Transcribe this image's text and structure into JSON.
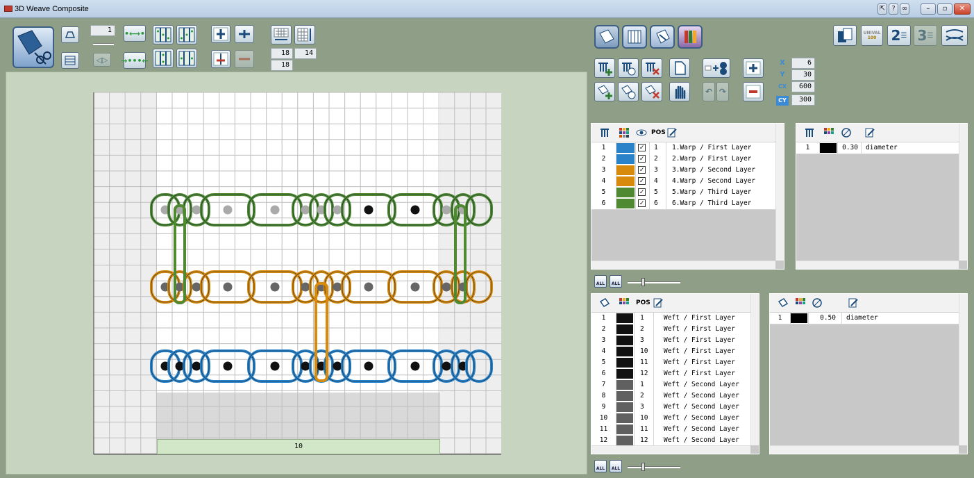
{
  "window": {
    "title": "3D Weave Composite"
  },
  "toolbar_left": {
    "layer_count_value": "1",
    "warp_count_value": "18",
    "weft_count_value": "14",
    "pass_value": "18"
  },
  "canvas": {
    "ruler_label": "10"
  },
  "toolbar_right": {
    "coord_x_label": "X",
    "coord_x_value": "6",
    "coord_y_label": "Y",
    "coord_y_value": "30",
    "coord_cx_label": "CX",
    "coord_cx_value": "600",
    "coord_cy_label": "CY",
    "coord_cy_value": "300",
    "unival_label": "UNIVAL",
    "unival_sub": "100"
  },
  "warp_table": {
    "col_pos": "POS",
    "rows": [
      {
        "idx": "1",
        "pos": "1",
        "name": "1.Warp / First Layer",
        "color": "#2a82c8"
      },
      {
        "idx": "2",
        "pos": "2",
        "name": "2.Warp / First Layer",
        "color": "#2a82c8"
      },
      {
        "idx": "3",
        "pos": "3",
        "name": "3.Warp / Second Layer",
        "color": "#d88a0c"
      },
      {
        "idx": "4",
        "pos": "4",
        "name": "4.Warp / Second Layer",
        "color": "#d88a0c"
      },
      {
        "idx": "5",
        "pos": "5",
        "name": "5.Warp / Third Layer",
        "color": "#4f8a32"
      },
      {
        "idx": "6",
        "pos": "6",
        "name": "6.Warp / Third Layer",
        "color": "#4f8a32"
      }
    ]
  },
  "warp_yarn_table": {
    "rows": [
      {
        "idx": "1",
        "diameter": "0.30",
        "name": "diameter"
      }
    ]
  },
  "weft_table": {
    "col_pos": "POS",
    "rows": [
      {
        "idx": "1",
        "pos": "1",
        "name": "Weft / First Layer",
        "color": "#111111"
      },
      {
        "idx": "2",
        "pos": "2",
        "name": "Weft / First Layer",
        "color": "#111111"
      },
      {
        "idx": "3",
        "pos": "3",
        "name": "Weft / First Layer",
        "color": "#111111"
      },
      {
        "idx": "4",
        "pos": "10",
        "name": "Weft / First Layer",
        "color": "#111111"
      },
      {
        "idx": "5",
        "pos": "11",
        "name": "Weft / First Layer",
        "color": "#111111"
      },
      {
        "idx": "6",
        "pos": "12",
        "name": "Weft / First Layer",
        "color": "#111111"
      },
      {
        "idx": "7",
        "pos": "1",
        "name": "Weft / Second Layer",
        "color": "#606060"
      },
      {
        "idx": "8",
        "pos": "2",
        "name": "Weft / Second Layer",
        "color": "#606060"
      },
      {
        "idx": "9",
        "pos": "3",
        "name": "Weft / Second Layer",
        "color": "#606060"
      },
      {
        "idx": "10",
        "pos": "10",
        "name": "Weft / Second Layer",
        "color": "#606060"
      },
      {
        "idx": "11",
        "pos": "11",
        "name": "Weft / Second Layer",
        "color": "#606060"
      },
      {
        "idx": "12",
        "pos": "12",
        "name": "Weft / Second Layer",
        "color": "#606060"
      }
    ]
  },
  "weft_yarn_table": {
    "rows": [
      {
        "idx": "1",
        "diameter": "0.50",
        "name": "diameter"
      }
    ]
  },
  "visibility": {
    "all_label": "ALL"
  },
  "colors": {
    "warp_blue": "#2a82c8",
    "warp_orange": "#d88a0c",
    "warp_green": "#4f8a32",
    "weft_black": "#111111",
    "weft_gray": "#808080"
  }
}
